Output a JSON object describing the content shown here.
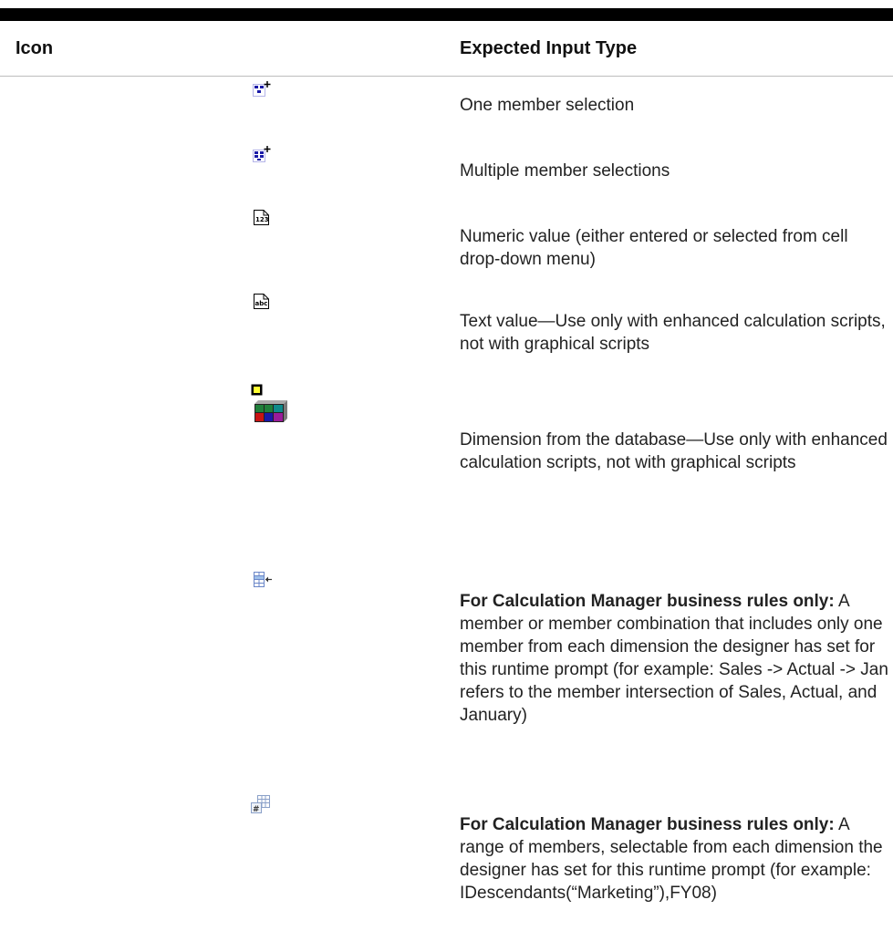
{
  "table": {
    "headers": {
      "icon": "Icon",
      "expected_input_type": "Expected Input Type"
    },
    "rows": [
      {
        "icon": "one-member-selection-icon",
        "text": "One member selection"
      },
      {
        "icon": "multiple-member-selection-icon",
        "text": "Multiple member selections"
      },
      {
        "icon": "numeric-value-icon",
        "text": "Numeric value (either entered or selected from cell drop-down menu)"
      },
      {
        "icon": "text-value-icon",
        "text": "Text value—Use only with enhanced calculation scripts, not with graphical scripts"
      },
      {
        "icon": "dimension-icon",
        "text": "Dimension from the database—Use only with enhanced calculation scripts, not with graphical scripts"
      },
      {
        "icon": "member-combination-icon",
        "bold": "For Calculation Manager business rules only:",
        "text": "A member or member combination that includes only one member from each dimension the designer has set for this runtime prompt (for example: Sales -> Actual -> Jan refers to the member intersection of Sales, Actual, and January)"
      },
      {
        "icon": "member-range-icon",
        "bold": "For Calculation Manager business rules only:",
        "text": "A range of members, selectable from each dimension the designer has set for this runtime prompt (for example: IDescendants(“Marketing”),FY08)"
      }
    ]
  }
}
